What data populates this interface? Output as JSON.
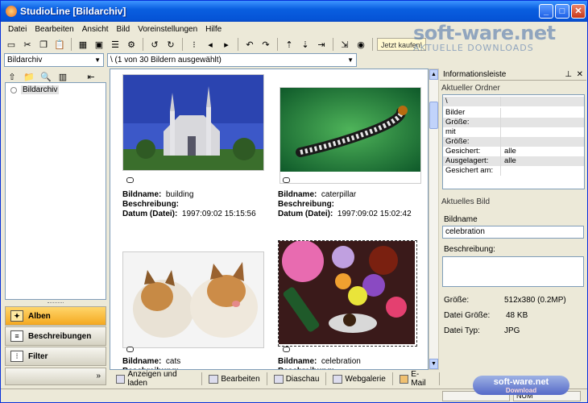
{
  "window": {
    "title": "StudioLine [Bildarchiv]",
    "min": "_",
    "max": "□",
    "close": "✕"
  },
  "menu": [
    "Datei",
    "Bearbeiten",
    "Ansicht",
    "Bild",
    "Voreinstellungen",
    "Hilfe"
  ],
  "toolbar": {
    "buy_label": "Jetzt kaufen!"
  },
  "address": {
    "archive_combo": "Bildarchiv",
    "path_combo": "\\ (1 von 30 Bildern ausgewählt)"
  },
  "tree": {
    "root": "Bildarchiv"
  },
  "nav": {
    "alben": "Alben",
    "beschreibungen": "Beschreibungen",
    "filter": "Filter",
    "more": "»"
  },
  "gallery": {
    "labels": {
      "name": "Bildname:",
      "desc": "Beschreibung:",
      "date": "Datum (Datei):"
    },
    "items": [
      {
        "name": "building",
        "date": "1997:09:02 15:15:56"
      },
      {
        "name": "caterpillar",
        "date": "1997:09:02 15:02:42"
      },
      {
        "name": "cats",
        "date": ""
      },
      {
        "name": "celebration",
        "date": ""
      }
    ]
  },
  "bottom_actions": [
    "Anzeigen und laden",
    "Bearbeiten",
    "Diaschau",
    "Webgalerie",
    "E-Mail"
  ],
  "info": {
    "title": "Informationsleiste",
    "pin": "⊥",
    "close": "✕",
    "current_folder_label": "Aktueller Ordner",
    "folder_path": "\\",
    "rows": [
      {
        "k": "Bilder",
        "v": ""
      },
      {
        "k": "  Größe:",
        "v": ""
      },
      {
        "k": "mit Unterordnern:",
        "v": ""
      },
      {
        "k": "  Größe:",
        "v": ""
      },
      {
        "k": "Gesichert:",
        "v": "alle"
      },
      {
        "k": "Ausgelagert:",
        "v": "alle"
      },
      {
        "k": "Gesichert am:",
        "v": ""
      }
    ],
    "current_image_label": "Aktuelles Bild",
    "name_label": "Bildname",
    "name_value": "celebration",
    "desc_label": "Beschreibung:",
    "size_label": "Größe:",
    "size_value": "512x380 (0.2MP)",
    "filesize_label": "Datei Größe:",
    "filesize_value": "48 KB",
    "filetype_label": "Datei Typ:",
    "filetype_value": "JPG"
  },
  "status": {
    "right": "NUM"
  },
  "watermark": {
    "brand": "soft-ware.net",
    "sub": "AKTUELLE DOWNLOADS",
    "badge": "soft-ware.net",
    "badge_sub": "Download"
  }
}
